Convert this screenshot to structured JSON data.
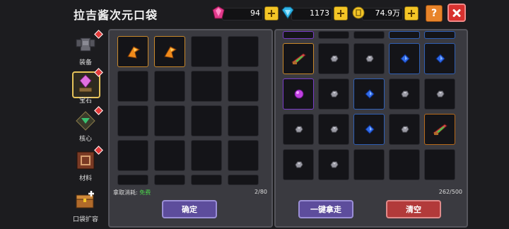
{
  "title": "拉吉酱次元口袋",
  "resources": {
    "gems": "94",
    "diamonds": "1173",
    "coins": "74.9万"
  },
  "colors": {
    "gem": "#e23a8c",
    "diamond": "#2fb4e8",
    "coin": "#f3c526"
  },
  "sidebar": {
    "items": [
      {
        "label": "装备",
        "icon": "armor-icon"
      },
      {
        "label": "宝石",
        "icon": "gem-altar-icon"
      },
      {
        "label": "核心",
        "icon": "core-icon"
      },
      {
        "label": "材料",
        "icon": "material-book-icon"
      },
      {
        "label": "口袋扩容",
        "icon": "chest-expand-icon"
      }
    ]
  },
  "left_panel": {
    "cost_label": "拿取消耗:",
    "cost_value": "免费",
    "count": "2/80",
    "confirm_label": "确定"
  },
  "right_panel": {
    "count": "262/500",
    "take_all_label": "一键拿走",
    "clear_label": "清空"
  }
}
